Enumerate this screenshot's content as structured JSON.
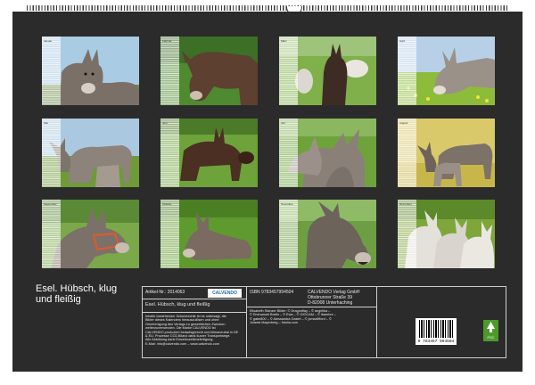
{
  "calendar": {
    "title_line1": "Esel. Hübsch, klug",
    "title_line2": "und fleißig",
    "months": [
      {
        "label": "Januar",
        "animal": "donkey-portrait-sky"
      },
      {
        "label": "Februar",
        "animal": "donkey-grazing"
      },
      {
        "label": "März",
        "animal": "donkey-with-foal-meadow"
      },
      {
        "label": "April",
        "animal": "donkey-flowers"
      },
      {
        "label": "Mai",
        "animal": "donkeys-pair-meadow"
      },
      {
        "label": "Juni",
        "animal": "donkey-herd-dark"
      },
      {
        "label": "Juli",
        "animal": "donkey-group-fence"
      },
      {
        "label": "August",
        "animal": "donkey-mother-foal"
      },
      {
        "label": "September",
        "animal": "donkey-halter-closeup"
      },
      {
        "label": "Oktober",
        "animal": "donkey-foal-lying"
      },
      {
        "label": "November",
        "animal": "donkey-braying"
      },
      {
        "label": "Dezember",
        "animal": "white-donkeys"
      }
    ]
  },
  "info": {
    "article_no": "Artikel-Nr.: 2014063",
    "logo": "CALVENDO",
    "isbn": "ISBN 9783457994504",
    "product_title": "Esel. Hübsch, klug und fleißig",
    "publisher_lines": [
      "CALVENDO Verlag GmbH",
      "Ottobrunner Straße 39",
      "D-82008 Unterhaching"
    ],
    "legal_lines": [
      "Inhalte bestehender Schutzrechte ist es untersagt, die",
      "Bilder dieses Kalenders herauszulösen und ohne",
      "Genehmigung des Verlags zu gewerblichen Zwecken",
      "weiterzuverwenden. Die Marke CALVENDO ist",
      "CALVENDO produziert bedarfsgerecht und klimaneutral in DE",
      "& EU. Prozesse CO2-Bilanz dank kurzer Transportwege.",
      "Alle Abbildung dank Einzelexzellenzfertigung.",
      "E-Mail: info@calvendo.com – www.calvendo.com"
    ],
    "credits_lines": [
      "Elisabeth Stanzer Bilder: © Dragonflay – © angelika –",
      "© Emmanuel Bretin – © Ewa – © GIOCAM – © ibambre –",
      "© gabe800 – © Alessandra Gaslet – © jcmaxlifford – ©",
      "Jolanta Mayerberg – fotolia.com"
    ],
    "barcode_number": "9 783457 994504",
    "fsc_label": "FSC"
  },
  "colors": {
    "board": "#2b2b2b",
    "text": "#ffffff",
    "meadow": "#5f9a2e",
    "sky": "#9fc6e2",
    "donkey_grey": "#8a8178",
    "donkey_brown": "#5a3e2b",
    "white_donkey": "#e6e4df"
  }
}
